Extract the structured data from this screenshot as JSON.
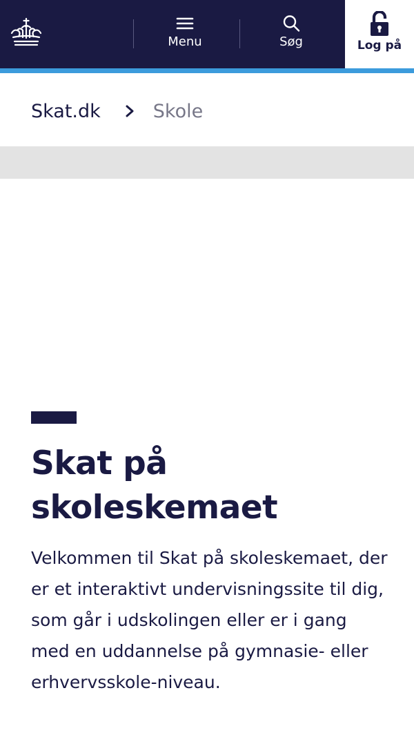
{
  "header": {
    "logo_icon": "crown-icon",
    "menu_label": "Menu",
    "menu_icon": "hamburger-icon",
    "search_label": "Søg",
    "search_icon": "search-icon",
    "login_label": "Log på",
    "login_icon": "unlocked-padlock-icon"
  },
  "breadcrumb": {
    "home_label": "Skat.dk",
    "separator_icon": "chevron-right-icon",
    "current_label": "Skole"
  },
  "main": {
    "title": "Skat på skoleskemaet",
    "intro": "Velkommen til Skat på skoleskemaet, der er et interaktivt undervisningssite til dig, som går i udskolingen eller er i gang med en uddannelse på gymnasie- eller erhvervsskole-niveau."
  },
  "colors": {
    "navy": "#1a1a43",
    "accent_blue": "#3c9bdc",
    "band_grey": "#e3e3e3",
    "muted_text": "#777788"
  }
}
